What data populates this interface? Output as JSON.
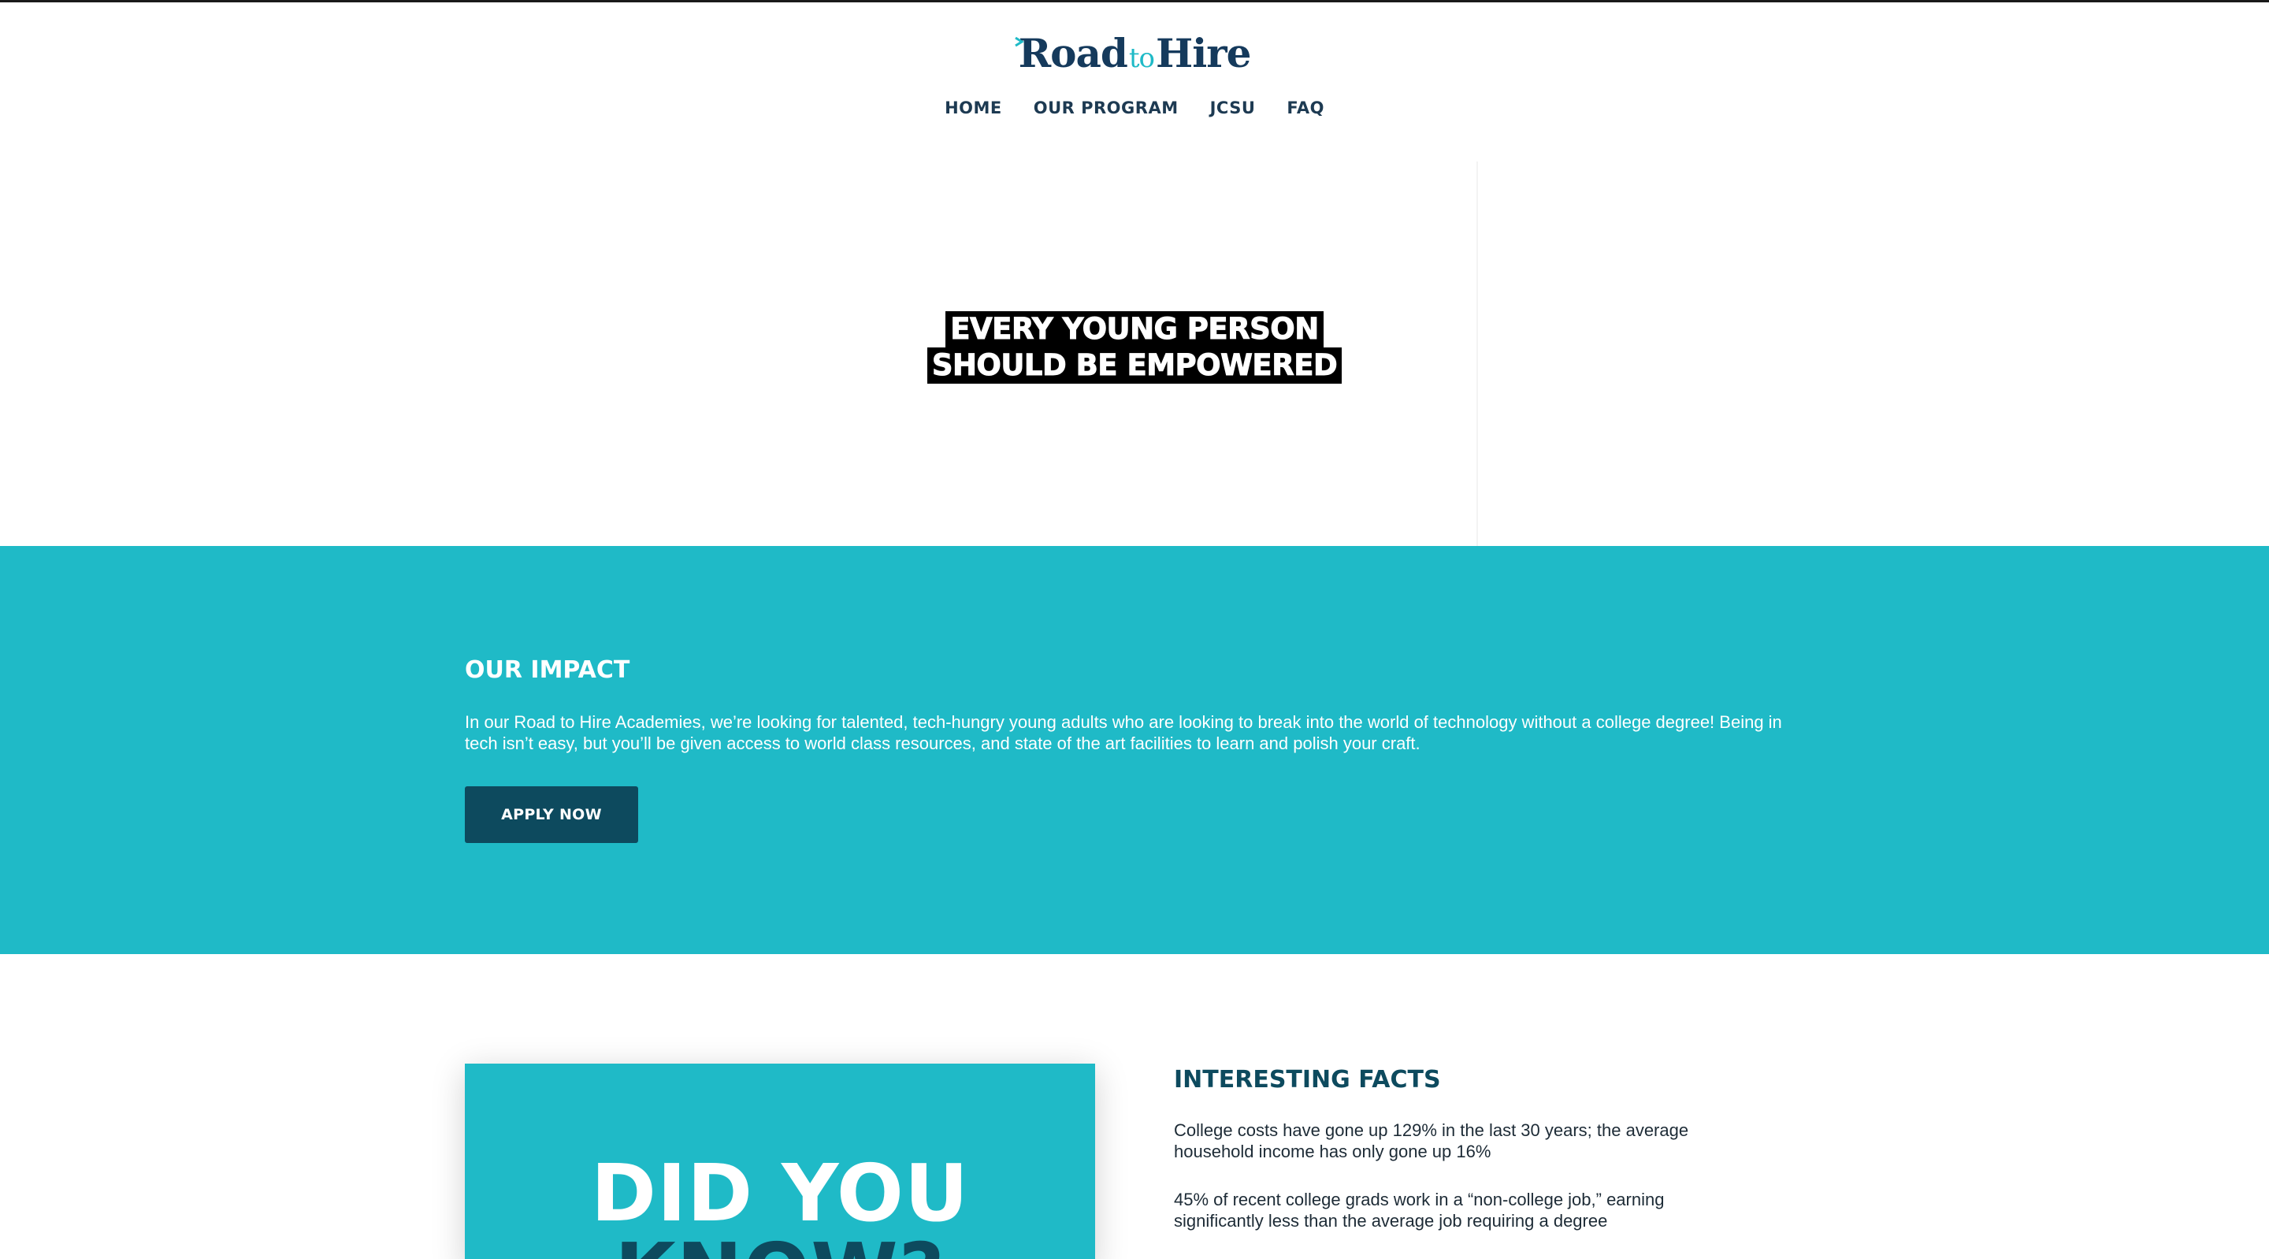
{
  "header": {
    "logo": {
      "part1": "Road",
      "part2": "to",
      "part3": "Hire"
    },
    "nav": [
      "HOME",
      "OUR PROGRAM",
      "JCSU",
      "FAQ"
    ]
  },
  "hero": {
    "line1": "EVERY YOUNG PERSON",
    "line2": "SHOULD BE EMPOWERED"
  },
  "impact": {
    "title": "OUR IMPACT",
    "text": "In our Road to Hire Academies, we’re looking for talented, tech-hungry young adults who are looking to break into the world of technology without a college degree! Being in tech isn’t easy, but you’ll be given access to world class resources, and state of the art facilities to learn and polish your craft.",
    "button": "APPLY NOW"
  },
  "did_you_know": {
    "line1": "DID YOU",
    "line2": "KNOW?"
  },
  "facts": {
    "title": "INTERESTING FACTS",
    "items": [
      "College costs have gone up 129% in the last 30 years; the average household income has only gone up 16%",
      "45% of recent college grads work in a “non-college job,” earning significantly less than the average job requiring a degree"
    ]
  },
  "colors": {
    "teal": "#1fbac7",
    "navy": "#0d4a5e",
    "logo_navy": "#153a5c"
  }
}
